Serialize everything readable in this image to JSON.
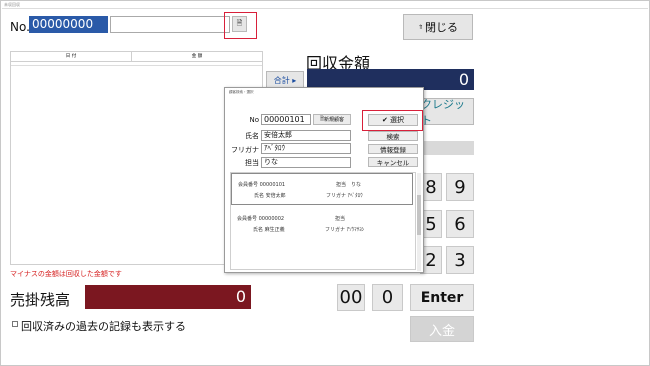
{
  "window": {
    "title": "未収回収"
  },
  "header": {
    "no_label": "No.",
    "no_value": "00000000",
    "search_value": "",
    "close_label": "閉じる"
  },
  "table": {
    "headers": [
      "日 付",
      "金 額"
    ]
  },
  "collection": {
    "title": "回収金額",
    "total_label": "合計 ▸",
    "total_value": "0",
    "credit_label": "クレジット",
    "keys_row1": [
      "8",
      "9"
    ],
    "keys_row2": [
      "5",
      "6"
    ],
    "keys_row3": [
      "2",
      "3"
    ],
    "key_00": "00",
    "key_0": "0",
    "enter_label": "Enter",
    "deposit_label": "入金"
  },
  "notes": {
    "minus_note": "マイナスの金額は回収した金額です"
  },
  "balance": {
    "label": "売掛残高",
    "value": "0"
  },
  "options": {
    "show_past_label": "回収済みの過去の記録も表示する"
  },
  "dialog": {
    "title": "顧客検索・選択",
    "no_label": "No",
    "no_value": "00000101",
    "new_label": "新規顧客",
    "select_label": "✔ 選択",
    "name_label": "氏名",
    "name_value": "安倍太郎",
    "kana_label": "フリガナ",
    "kana_value": "ｱﾍﾞﾀﾛｳ",
    "staff_label": "担当",
    "staff_value": "りな",
    "search_label": "検索",
    "register_label": "情報登録",
    "cancel_label": "キャンセル",
    "results": [
      {
        "member_label": "会員番号",
        "member_no": "00000101",
        "staff_label": "担当",
        "staff": "りな",
        "name_label": "氏名",
        "name": "安倍太郎",
        "kana_label": "フリガナ",
        "kana": "ｱﾍﾞﾀﾛｳ"
      },
      {
        "member_label": "会員番号",
        "member_no": "00000002",
        "staff_label": "担当",
        "staff": "",
        "name_label": "氏名",
        "name": "麻生正義",
        "kana_label": "フリガナ",
        "kana": "ｱｿｳﾏｻﾖｼ"
      }
    ]
  }
}
